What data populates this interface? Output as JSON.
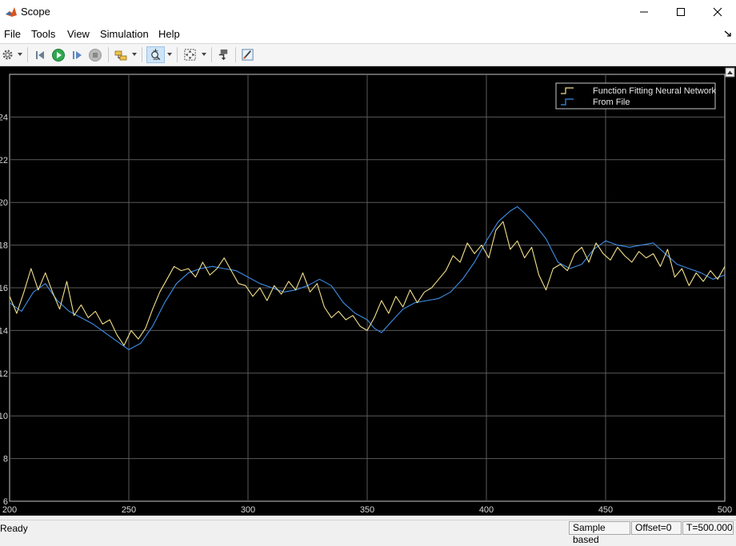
{
  "window": {
    "title": "Scope"
  },
  "menu": {
    "items": [
      "File",
      "Tools",
      "View",
      "Simulation",
      "Help"
    ]
  },
  "toolbar": {
    "buttons": [
      "settings-icon",
      "step-back-icon",
      "run-icon",
      "step-forward-icon",
      "stop-icon",
      "signal-selector-icon",
      "zoom-icon",
      "fit-to-view-icon",
      "highlight-block-icon",
      "style-icon"
    ],
    "selected": "zoom-icon"
  },
  "chart_data": {
    "type": "line",
    "xlim": [
      200,
      500
    ],
    "ylim": [
      6,
      26
    ],
    "x_ticks": [
      "200",
      "250",
      "300",
      "350",
      "400",
      "450",
      "500"
    ],
    "y_ticks": [
      "6",
      "8",
      "10",
      "12",
      "14",
      "16",
      "18",
      "20",
      "22",
      "24"
    ],
    "grid": true,
    "legend_position": "top-right",
    "series": [
      {
        "name": "Function Fitting Neural Network",
        "color": "#f2e08a",
        "x": [
          200,
          203,
          206,
          209,
          212,
          215,
          218,
          221,
          224,
          227,
          230,
          233,
          236,
          239,
          242,
          245,
          248,
          251,
          254,
          257,
          260,
          263,
          266,
          269,
          272,
          275,
          278,
          281,
          284,
          287,
          290,
          293,
          296,
          299,
          302,
          305,
          308,
          311,
          314,
          317,
          320,
          323,
          326,
          329,
          332,
          335,
          338,
          341,
          344,
          347,
          350,
          353,
          356,
          359,
          362,
          365,
          368,
          371,
          374,
          377,
          380,
          383,
          386,
          389,
          392,
          395,
          398,
          401,
          404,
          407,
          410,
          413,
          416,
          419,
          422,
          425,
          428,
          431,
          434,
          437,
          440,
          443,
          446,
          449,
          452,
          455,
          458,
          461,
          464,
          467,
          470,
          473,
          476,
          479,
          482,
          485,
          488,
          491,
          494,
          497,
          500
        ],
        "y": [
          15.6,
          14.8,
          15.8,
          16.9,
          15.9,
          16.7,
          15.8,
          15.0,
          16.3,
          14.7,
          15.2,
          14.6,
          14.9,
          14.3,
          14.5,
          13.8,
          13.3,
          14.0,
          13.6,
          14.1,
          15.0,
          15.8,
          16.4,
          17.0,
          16.8,
          16.9,
          16.5,
          17.2,
          16.6,
          16.9,
          17.4,
          16.8,
          16.2,
          16.1,
          15.6,
          16.0,
          15.4,
          16.1,
          15.7,
          16.3,
          15.9,
          16.7,
          15.8,
          16.2,
          15.1,
          14.6,
          14.9,
          14.5,
          14.7,
          14.2,
          14.0,
          14.6,
          15.4,
          14.8,
          15.6,
          15.1,
          15.9,
          15.3,
          15.8,
          16.0,
          16.4,
          16.8,
          17.5,
          17.2,
          18.1,
          17.6,
          18.0,
          17.4,
          18.7,
          19.1,
          17.8,
          18.2,
          17.4,
          17.9,
          16.6,
          15.9,
          16.9,
          17.1,
          16.8,
          17.6,
          17.9,
          17.2,
          18.1,
          17.6,
          17.3,
          17.9,
          17.5,
          17.2,
          17.7,
          17.4,
          17.6,
          17.0,
          17.8,
          16.5,
          16.9,
          16.1,
          16.7,
          16.3,
          16.8,
          16.4,
          17.0
        ]
      },
      {
        "name": "From File",
        "color": "#3e8ee8",
        "x": [
          200,
          205,
          210,
          215,
          220,
          225,
          230,
          235,
          240,
          245,
          250,
          255,
          260,
          265,
          270,
          275,
          280,
          285,
          290,
          295,
          300,
          305,
          310,
          315,
          320,
          325,
          330,
          335,
          340,
          345,
          350,
          353,
          356,
          360,
          365,
          370,
          375,
          380,
          385,
          390,
          395,
          400,
          405,
          410,
          413,
          416,
          420,
          425,
          430,
          435,
          440,
          445,
          450,
          455,
          460,
          465,
          470,
          475,
          480,
          485,
          490,
          495,
          500
        ],
        "y": [
          15.3,
          14.9,
          15.8,
          16.2,
          15.4,
          14.9,
          14.6,
          14.3,
          13.9,
          13.5,
          13.1,
          13.4,
          14.2,
          15.3,
          16.2,
          16.7,
          16.9,
          17.0,
          16.9,
          16.8,
          16.5,
          16.2,
          16.0,
          15.8,
          15.9,
          16.1,
          16.4,
          16.1,
          15.3,
          14.8,
          14.5,
          14.1,
          13.9,
          14.4,
          15.0,
          15.3,
          15.4,
          15.5,
          15.8,
          16.4,
          17.2,
          18.2,
          19.1,
          19.6,
          19.8,
          19.5,
          19.0,
          18.3,
          17.2,
          16.9,
          17.1,
          17.8,
          18.2,
          18.0,
          17.9,
          18.0,
          18.1,
          17.6,
          17.1,
          16.9,
          16.7,
          16.4,
          16.6
        ]
      }
    ]
  },
  "status": {
    "left": "Ready",
    "sample": "Sample based",
    "offset": "Offset=0",
    "time": "T=500.000"
  }
}
